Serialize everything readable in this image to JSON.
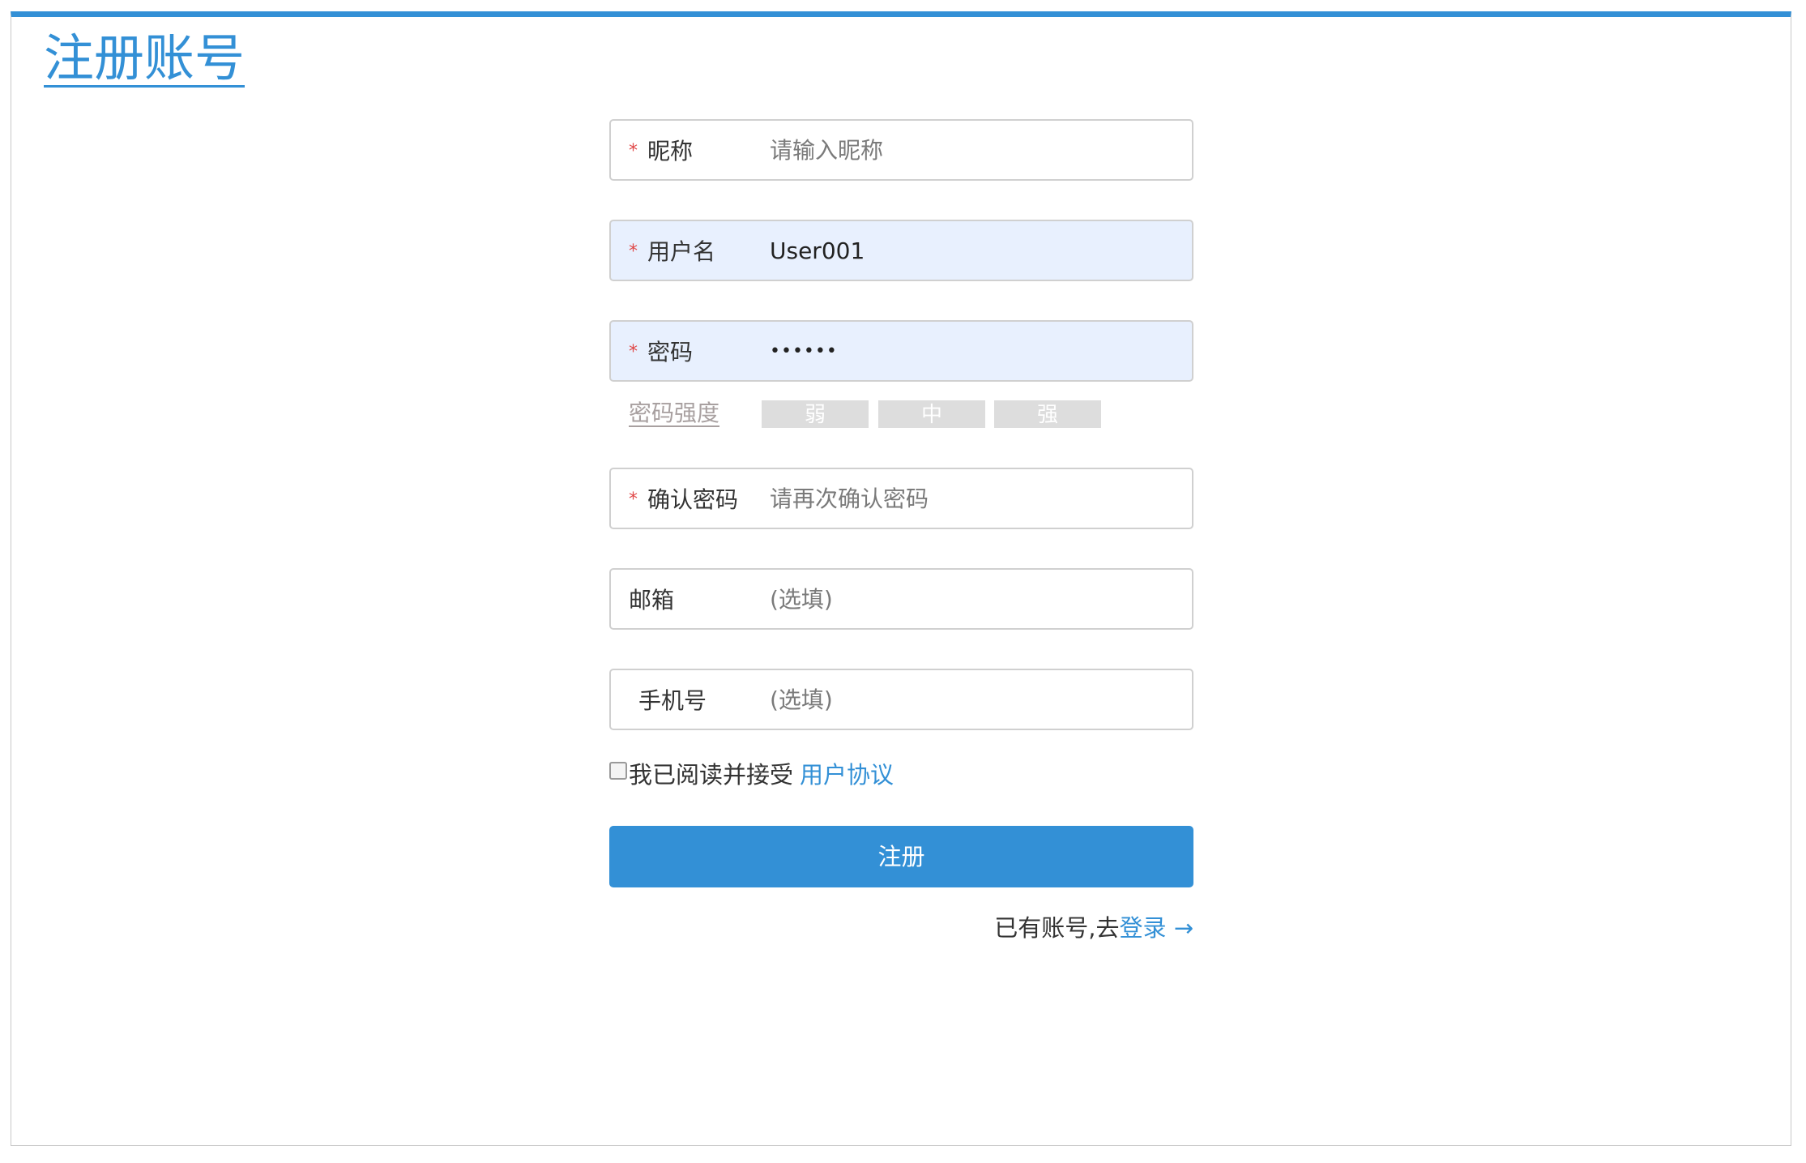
{
  "page": {
    "title": "注册账号"
  },
  "colors": {
    "accent": "#3390d6",
    "required": "#e04848",
    "autofill_bg": "#e8f0fe",
    "strength_bar_bg": "#dddddd"
  },
  "form": {
    "required_mark": "*",
    "nickname": {
      "label": "昵称",
      "value": "",
      "placeholder": "请输入昵称"
    },
    "username": {
      "label": "用户名",
      "value": "User001",
      "placeholder": ""
    },
    "password": {
      "label": "密码",
      "value": "••••••",
      "placeholder": ""
    },
    "strength": {
      "label": "密码强度",
      "levels": [
        "弱",
        "中",
        "强"
      ]
    },
    "confirm_password": {
      "label": "确认密码",
      "value": "",
      "placeholder": "请再次确认密码"
    },
    "email": {
      "label": "邮箱",
      "value": "",
      "placeholder": "(选填)"
    },
    "phone": {
      "label": "手机号",
      "value": "",
      "placeholder": "(选填)"
    },
    "agreement": {
      "checked": false,
      "text": "我已阅读并接受",
      "link": "用户协议"
    },
    "submit_label": "注册",
    "login": {
      "text": "已有账号,去",
      "link": "登录",
      "arrow": "→"
    }
  }
}
